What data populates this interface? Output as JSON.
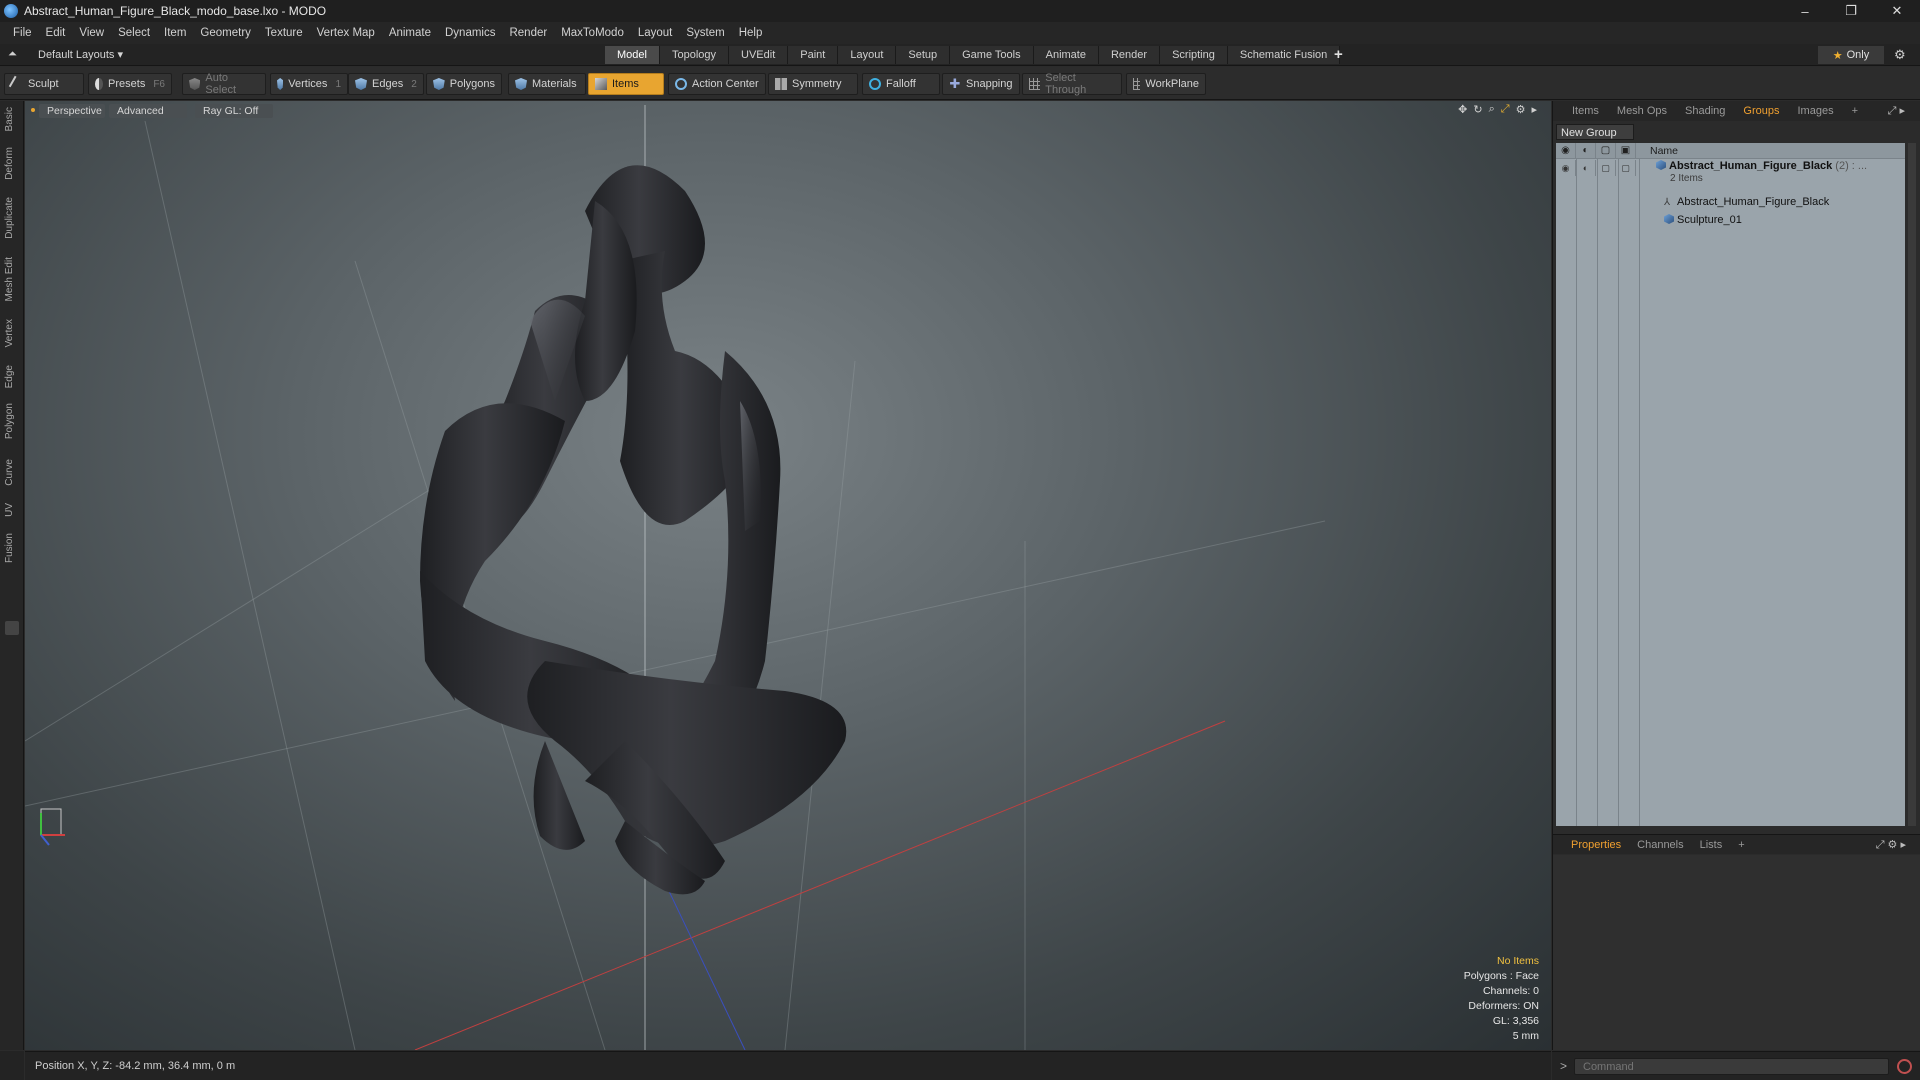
{
  "window": {
    "title": "Abstract_Human_Figure_Black_modo_base.lxo - MODO",
    "controls": [
      "–",
      "❐",
      "✕"
    ]
  },
  "menu": [
    "File",
    "Edit",
    "View",
    "Select",
    "Item",
    "Geometry",
    "Texture",
    "Vertex Map",
    "Animate",
    "Dynamics",
    "Render",
    "MaxToModo",
    "Layout",
    "System",
    "Help"
  ],
  "layout_bar": {
    "dropdown": "Default Layouts ▾",
    "tabs": [
      {
        "label": "Model",
        "active": true
      },
      {
        "label": "Topology",
        "active": false
      },
      {
        "label": "UVEdit",
        "active": false
      },
      {
        "label": "Paint",
        "active": false
      },
      {
        "label": "Layout",
        "active": false
      },
      {
        "label": "Setup",
        "active": false
      },
      {
        "label": "Game Tools",
        "active": false
      },
      {
        "label": "Animate",
        "active": false
      },
      {
        "label": "Render",
        "active": false
      },
      {
        "label": "Scripting",
        "active": false
      },
      {
        "label": "Schematic Fusion",
        "active": false
      }
    ],
    "only_label": "Only"
  },
  "toolbar": {
    "sculpt": "Sculpt",
    "presets": "Presets",
    "presets_key": "F6",
    "auto_select": "Auto Select",
    "vertices": "Vertices",
    "vertices_key": "1",
    "edges": "Edges",
    "edges_key": "2",
    "polygons": "Polygons",
    "materials": "Materials",
    "items": "Items",
    "action_center": "Action Center",
    "symmetry": "Symmetry",
    "falloff": "Falloff",
    "snapping": "Snapping",
    "select_through": "Select Through",
    "workplane": "WorkPlane"
  },
  "left_tabs": [
    "Basic",
    "Deform",
    "Duplicate",
    "Mesh Edit",
    "Vertex",
    "Edge",
    "Polygon",
    "Curve",
    "UV",
    "Fusion"
  ],
  "viewport": {
    "view_mode": "Perspective",
    "shading": "Advanced",
    "raygl": "Ray GL: Off",
    "info": {
      "selection": "No Items",
      "polygons": "Polygons : Face",
      "channels": "Channels: 0",
      "deformers": "Deformers: ON",
      "gl": "GL: 3,356",
      "unit": "5 mm"
    }
  },
  "right_panel": {
    "tabs": [
      {
        "label": "Items",
        "active": false
      },
      {
        "label": "Mesh Ops",
        "active": false
      },
      {
        "label": "Shading",
        "active": false
      },
      {
        "label": "Groups",
        "active": true
      },
      {
        "label": "Images",
        "active": false
      }
    ],
    "new_group": "New Group",
    "column_name": "Name",
    "group": {
      "name": "Abstract_Human_Figure_Black",
      "count": "(2) : ...",
      "sub": "2 Items"
    },
    "children": [
      {
        "name": "Abstract_Human_Figure_Black",
        "icon": "locator-icon"
      },
      {
        "name": "Sculpture_01",
        "icon": "mesh-icon"
      }
    ],
    "prop_tabs": [
      {
        "label": "Properties",
        "active": true
      },
      {
        "label": "Channels",
        "active": false
      },
      {
        "label": "Lists",
        "active": false
      }
    ]
  },
  "status": {
    "position": "Position X, Y, Z:   -84.2 mm, 36.4 mm, 0 m"
  },
  "command": {
    "placeholder": "Command"
  }
}
